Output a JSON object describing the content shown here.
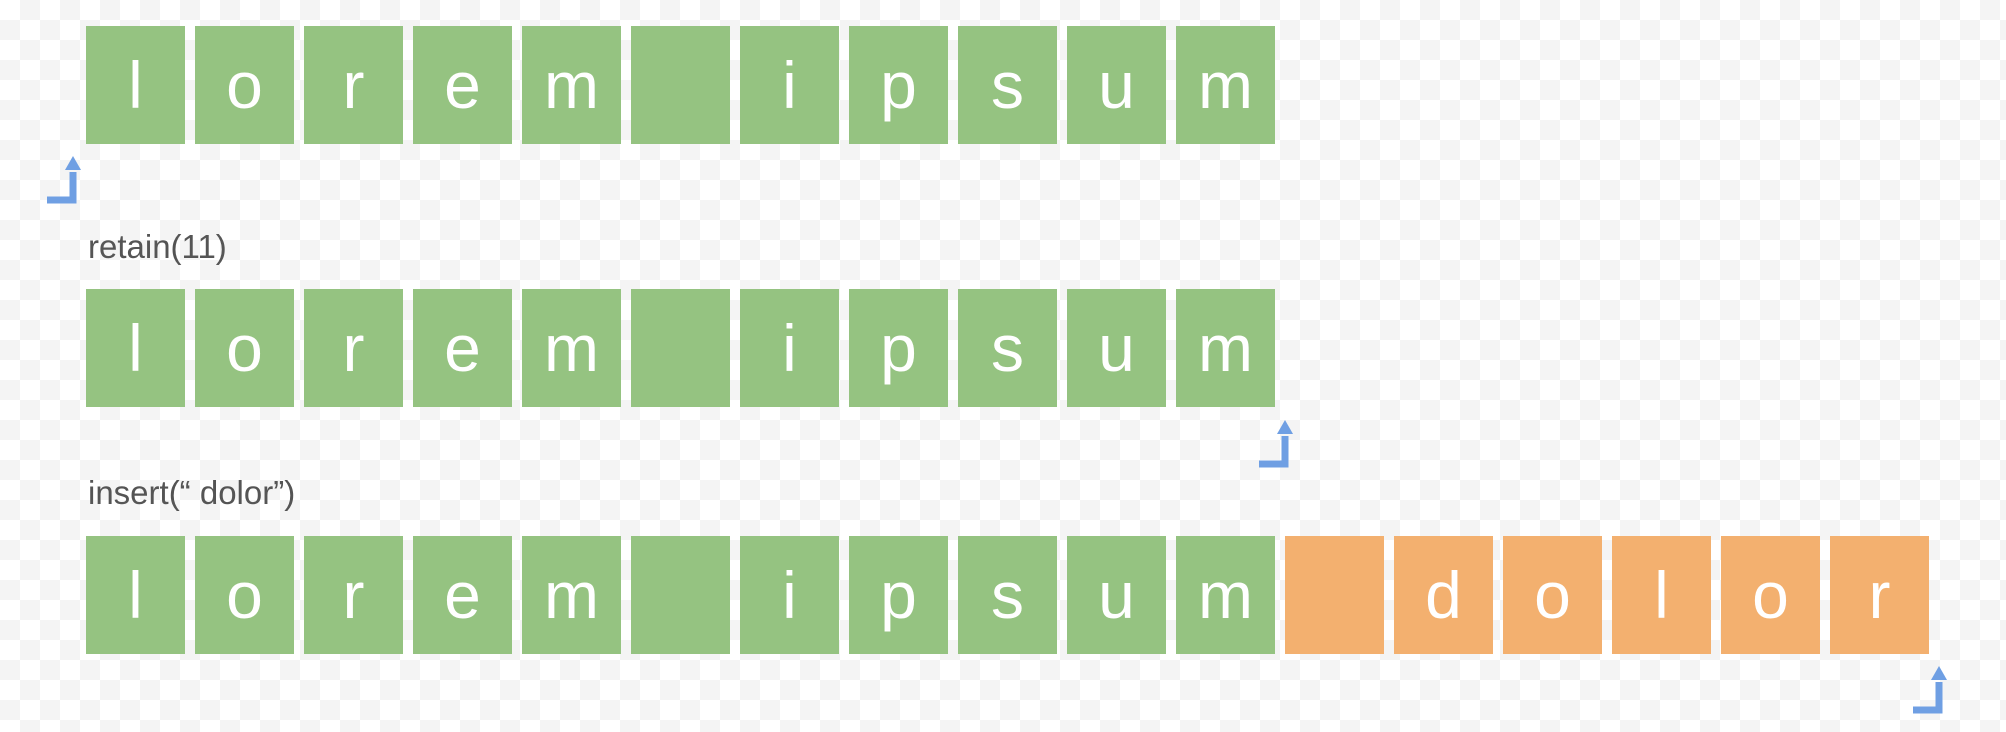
{
  "rows": [
    {
      "cells": [
        {
          "char": "l",
          "kind": "retained"
        },
        {
          "char": "o",
          "kind": "retained"
        },
        {
          "char": "r",
          "kind": "retained"
        },
        {
          "char": "e",
          "kind": "retained"
        },
        {
          "char": "m",
          "kind": "retained"
        },
        {
          "char": " ",
          "kind": "retained"
        },
        {
          "char": "i",
          "kind": "retained"
        },
        {
          "char": "p",
          "kind": "retained"
        },
        {
          "char": "s",
          "kind": "retained"
        },
        {
          "char": "u",
          "kind": "retained"
        },
        {
          "char": "m",
          "kind": "retained"
        }
      ]
    },
    {
      "cells": [
        {
          "char": "l",
          "kind": "retained"
        },
        {
          "char": "o",
          "kind": "retained"
        },
        {
          "char": "r",
          "kind": "retained"
        },
        {
          "char": "e",
          "kind": "retained"
        },
        {
          "char": "m",
          "kind": "retained"
        },
        {
          "char": " ",
          "kind": "retained"
        },
        {
          "char": "i",
          "kind": "retained"
        },
        {
          "char": "p",
          "kind": "retained"
        },
        {
          "char": "s",
          "kind": "retained"
        },
        {
          "char": "u",
          "kind": "retained"
        },
        {
          "char": "m",
          "kind": "retained"
        }
      ]
    },
    {
      "cells": [
        {
          "char": "l",
          "kind": "retained"
        },
        {
          "char": "o",
          "kind": "retained"
        },
        {
          "char": "r",
          "kind": "retained"
        },
        {
          "char": "e",
          "kind": "retained"
        },
        {
          "char": "m",
          "kind": "retained"
        },
        {
          "char": " ",
          "kind": "retained"
        },
        {
          "char": "i",
          "kind": "retained"
        },
        {
          "char": "p",
          "kind": "retained"
        },
        {
          "char": "s",
          "kind": "retained"
        },
        {
          "char": "u",
          "kind": "retained"
        },
        {
          "char": "m",
          "kind": "retained"
        },
        {
          "char": " ",
          "kind": "inserted"
        },
        {
          "char": "d",
          "kind": "inserted"
        },
        {
          "char": "o",
          "kind": "inserted"
        },
        {
          "char": "l",
          "kind": "inserted"
        },
        {
          "char": "o",
          "kind": "inserted"
        },
        {
          "char": "r",
          "kind": "inserted"
        }
      ]
    }
  ],
  "operations": [
    {
      "label": "retain(11)"
    },
    {
      "label": "insert(“ dolor”)"
    }
  ],
  "cursor_positions": [
    0,
    11,
    17
  ],
  "colors": {
    "retained": "#95c381",
    "inserted": "#f3b06f",
    "cursor": "#6f9fe3",
    "cell_text": "#ffffff",
    "label_text": "#555555"
  },
  "icons": {
    "cursor": "cursor-arrow-icon"
  }
}
